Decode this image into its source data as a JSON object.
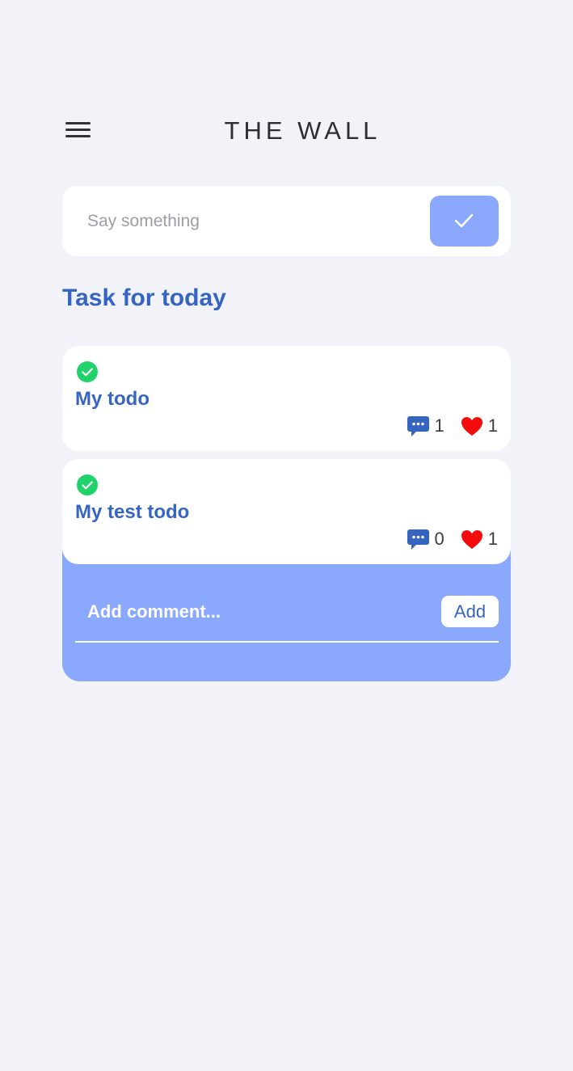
{
  "header": {
    "title": "THE WALL",
    "menu_icon": "hamburger-menu-icon"
  },
  "composer": {
    "placeholder": "Say something",
    "value": "",
    "submit_icon": "checkmark-icon"
  },
  "section": {
    "title": "Task for today"
  },
  "todos": [
    {
      "title": "My todo",
      "completed": true,
      "comments": "1",
      "likes": "1"
    },
    {
      "title": "My test todo",
      "completed": true,
      "comments": "0",
      "likes": "1"
    }
  ],
  "comment_form": {
    "placeholder": "Add comment...",
    "value": "",
    "add_label": "Add"
  },
  "colors": {
    "background": "#f1f3f8",
    "accent": "#8aa8fc",
    "primary_text": "#3565c0",
    "check_green": "#1fd36a",
    "heart_red": "#f20c0c",
    "comment_icon_blue": "#3565c0"
  }
}
